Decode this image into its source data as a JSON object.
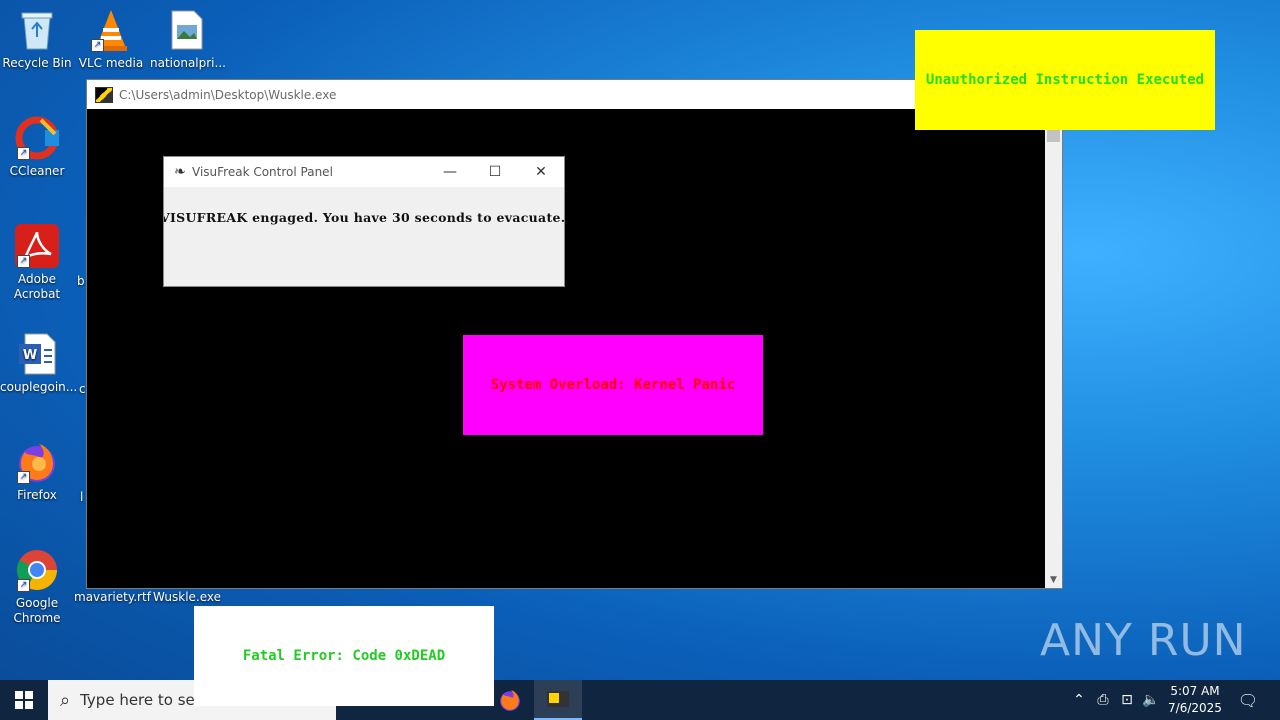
{
  "desktop": {
    "icons": [
      {
        "label": "Recycle Bin",
        "icon": "recycle-bin-icon"
      },
      {
        "label": "VLC media",
        "icon": "vlc-icon"
      },
      {
        "label": "nationalpri...",
        "icon": "image-file-icon"
      },
      {
        "label": "CCleaner",
        "icon": "ccleaner-icon"
      },
      {
        "label": "Adobe Acrobat",
        "icon": "acrobat-icon"
      },
      {
        "label": "couplegoin...",
        "icon": "word-doc-icon"
      },
      {
        "label": "Firefox",
        "icon": "firefox-icon"
      },
      {
        "label": "Google Chrome",
        "icon": "chrome-icon"
      },
      {
        "label": "mavariety.rtf",
        "icon": "rtf-file-icon"
      },
      {
        "label": "Wuskle.exe",
        "icon": "exe-file-icon"
      }
    ],
    "partial_labels": [
      "b",
      "c",
      "l"
    ]
  },
  "console": {
    "title": "C:\\Users\\admin\\Desktop\\Wuskle.exe"
  },
  "control_panel": {
    "title": "VisuFreak Control Panel",
    "message": "VISUFREAK engaged. You have 30 seconds to evacuate."
  },
  "popups": {
    "unauthorized": {
      "text": "Unauthorized Instruction Executed",
      "bg": "#ffff00",
      "fg": "#22dd22"
    },
    "overload": {
      "text": "System Overload: Kernel Panic",
      "bg": "#ff00ff",
      "fg": "#ff0000"
    },
    "fatal": {
      "text": "Fatal Error: Code 0xDEAD",
      "bg": "#ffffff",
      "fg": "#22cc22"
    }
  },
  "taskbar": {
    "search_placeholder": "Type here to sea",
    "time": "5:07 AM",
    "date": "7/6/2025"
  },
  "watermark": {
    "text": "ANY RUN"
  }
}
